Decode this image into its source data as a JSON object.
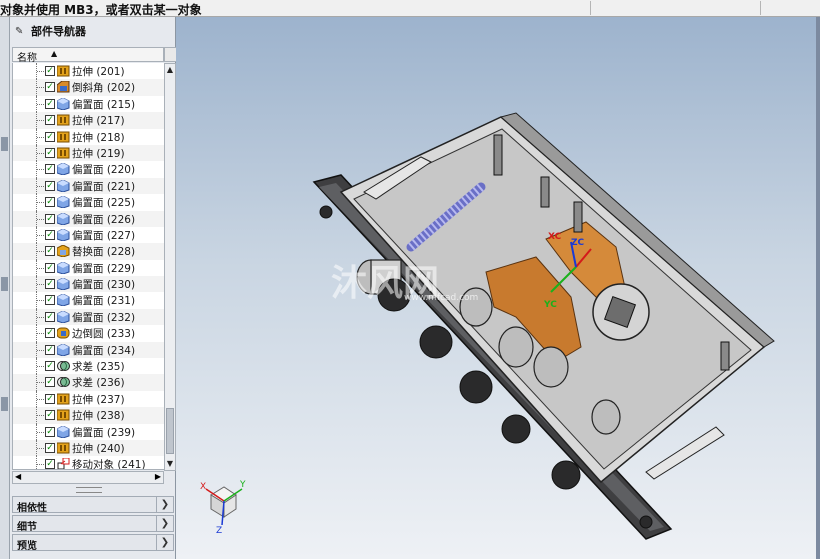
{
  "status_bar": {
    "message": "对象并使用 MB3，或者双击某一对象"
  },
  "navigator": {
    "title": "部件导航器",
    "column_name": "名称",
    "items": [
      {
        "label": "拉伸 (201)",
        "icon": "extrude-icon"
      },
      {
        "label": "倒斜角 (202)",
        "icon": "chamfer-icon"
      },
      {
        "label": "偏置面 (215)",
        "icon": "offset-face-icon"
      },
      {
        "label": "拉伸 (217)",
        "icon": "extrude-icon"
      },
      {
        "label": "拉伸 (218)",
        "icon": "extrude-icon"
      },
      {
        "label": "拉伸 (219)",
        "icon": "extrude-icon"
      },
      {
        "label": "偏置面 (220)",
        "icon": "offset-face-icon"
      },
      {
        "label": "偏置面 (221)",
        "icon": "offset-face-icon"
      },
      {
        "label": "偏置面 (225)",
        "icon": "offset-face-icon"
      },
      {
        "label": "偏置面 (226)",
        "icon": "offset-face-icon"
      },
      {
        "label": "偏置面 (227)",
        "icon": "offset-face-icon"
      },
      {
        "label": "替换面 (228)",
        "icon": "replace-face-icon"
      },
      {
        "label": "偏置面 (229)",
        "icon": "offset-face-icon"
      },
      {
        "label": "偏置面 (230)",
        "icon": "offset-face-icon"
      },
      {
        "label": "偏置面 (231)",
        "icon": "offset-face-icon"
      },
      {
        "label": "偏置面 (232)",
        "icon": "offset-face-icon"
      },
      {
        "label": "边倒圆 (233)",
        "icon": "edge-blend-icon"
      },
      {
        "label": "偏置面 (234)",
        "icon": "offset-face-icon"
      },
      {
        "label": "求差 (235)",
        "icon": "subtract-icon"
      },
      {
        "label": "求差 (236)",
        "icon": "subtract-icon"
      },
      {
        "label": "拉伸 (237)",
        "icon": "extrude-icon"
      },
      {
        "label": "拉伸 (238)",
        "icon": "extrude-icon"
      },
      {
        "label": "偏置面 (239)",
        "icon": "offset-face-icon"
      },
      {
        "label": "拉伸 (240)",
        "icon": "extrude-icon"
      },
      {
        "label": "移动对象 (241)",
        "icon": "move-object-icon"
      }
    ],
    "sections": [
      {
        "label": "相依性"
      },
      {
        "label": "细节"
      },
      {
        "label": "预览"
      }
    ]
  },
  "viewport": {
    "watermark": {
      "main": "沐风网",
      "url": "www.mfcad.com"
    },
    "wcs_labels": {
      "x": "XC",
      "y": "YC",
      "z": "ZC"
    },
    "triad_labels": {
      "x": "X",
      "y": "Y",
      "z": "Z"
    }
  },
  "colors": {
    "accent": "#c87a2e",
    "check": "#0a8a0a",
    "background_top": "#9db3cd",
    "background_bottom": "#eef1f5"
  }
}
